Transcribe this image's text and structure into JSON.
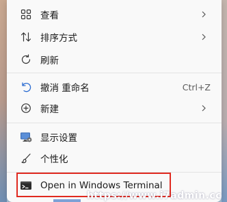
{
  "menu": {
    "items": [
      {
        "label": "查看",
        "icon": "view-grid-icon",
        "submenu": true
      },
      {
        "label": "排序方式",
        "icon": "sort-icon",
        "submenu": true
      },
      {
        "label": "刷新",
        "icon": "refresh-icon",
        "submenu": false
      },
      {
        "label": "撤消 重命名",
        "icon": "undo-icon",
        "shortcut": "Ctrl+Z"
      },
      {
        "label": "新建",
        "icon": "new-plus-icon",
        "submenu": true
      },
      {
        "label": "显示设置",
        "icon": "display-settings-icon"
      },
      {
        "label": "个性化",
        "icon": "personalize-brush-icon"
      },
      {
        "label": "Open in Windows Terminal",
        "icon": "terminal-icon"
      }
    ]
  },
  "watermark": "https://www.i7admin.cc",
  "colors": {
    "menu_bg": "#f9f9f9",
    "highlight_border": "#e0291f",
    "separator": "#e3e3e3"
  }
}
